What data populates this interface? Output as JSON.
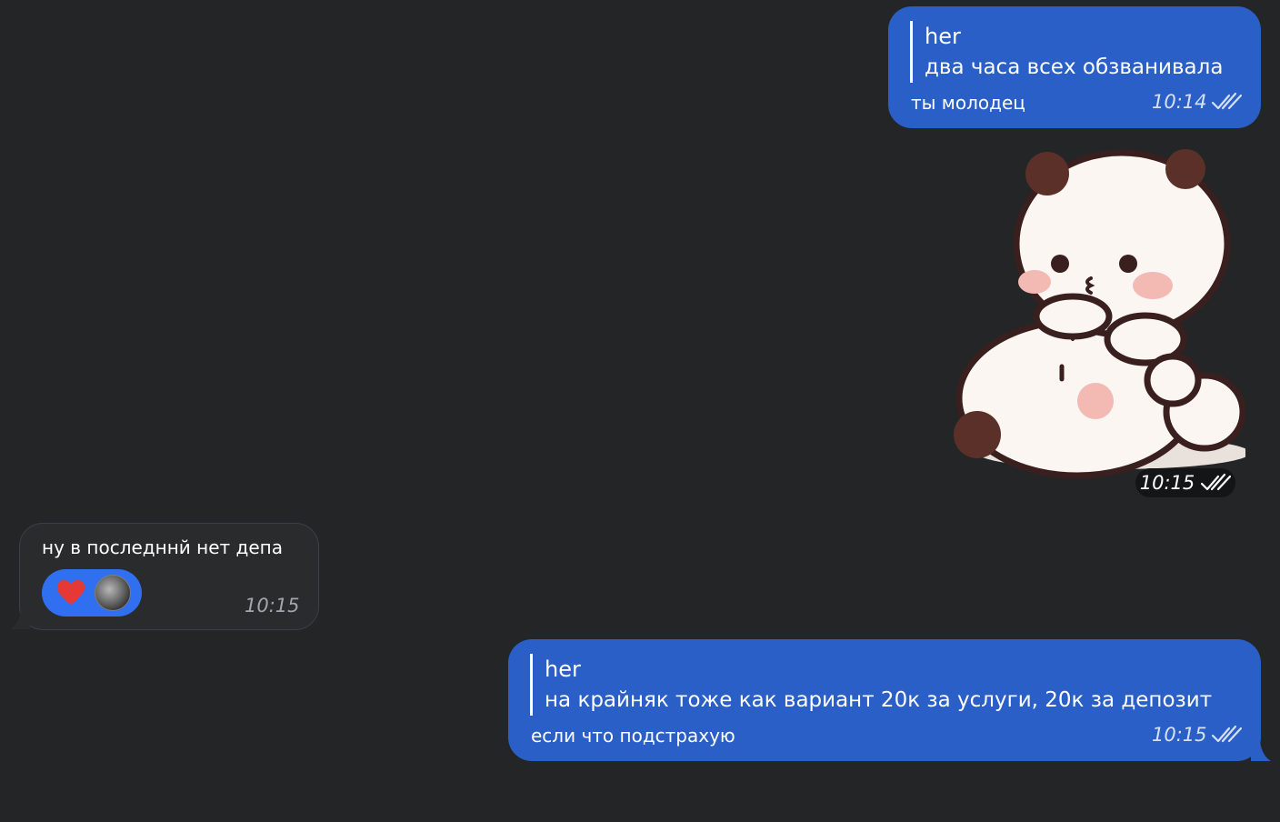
{
  "messages": [
    {
      "id": "m1",
      "direction": "outgoing",
      "reply": {
        "name": "her",
        "text": "два часа всех обзванивала"
      },
      "text": "ты молодец",
      "time": "10:14",
      "status": "read-double-check"
    },
    {
      "id": "m2",
      "direction": "outgoing",
      "type": "sticker",
      "sticker_icon": "panda-hug-sticker",
      "time": "10:15",
      "status": "read-double-check"
    },
    {
      "id": "m3",
      "direction": "incoming",
      "text": "ну в последннй нет депа",
      "time": "10:15",
      "reactions": [
        {
          "icon": "heart-emoji",
          "reactor": "user-avatar"
        }
      ]
    },
    {
      "id": "m4",
      "direction": "outgoing",
      "reply": {
        "name": "her",
        "text": "на крайняк тоже как вариант  20к за услуги, 20к за депозит"
      },
      "text": "если что подстрахую",
      "time": "10:15",
      "status": "read-double-check"
    }
  ],
  "colors": {
    "background": "#232527",
    "outgoing_bubble": "#2a5fc7",
    "incoming_bubble": "#2a2b2d",
    "reaction_pill": "#2f6ff0",
    "heart": "#e53935"
  }
}
